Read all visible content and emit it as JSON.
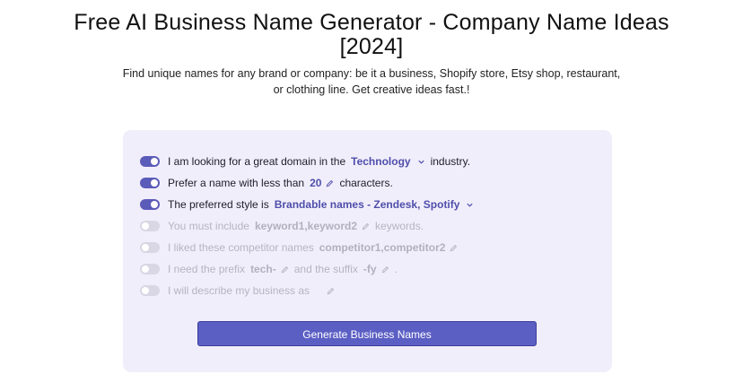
{
  "page": {
    "title_line1": "Free AI Business Name Generator - Company Name Ideas",
    "title_line2": "[2024]",
    "subtitle": "Find unique names for any brand or company: be it a business, Shopify store, Etsy shop, restaurant, or clothing line. Get creative ideas fast.!"
  },
  "form": {
    "rows": [
      {
        "enabled": true,
        "before": "I am looking for a great domain in the",
        "value": "Technology",
        "after": "industry."
      },
      {
        "enabled": true,
        "before": "Prefer a name with less than",
        "value": "20",
        "after": "characters."
      },
      {
        "enabled": true,
        "before": "The preferred style is",
        "value": "Brandable names - Zendesk, Spotify",
        "after": ""
      },
      {
        "enabled": false,
        "before": "You must include",
        "value": "keyword1,keyword2",
        "after": "keywords."
      },
      {
        "enabled": false,
        "before": "I liked these competitor names",
        "value": "competitor1,competitor2",
        "after": ""
      },
      {
        "enabled": false,
        "before": "I need the prefix",
        "value": "tech-",
        "middle": "and the suffix",
        "value2": "-fy",
        "after": "."
      },
      {
        "enabled": false,
        "before": "I will describe my business as",
        "value": "",
        "after": ""
      }
    ],
    "generate_label": "Generate Business Names"
  },
  "icons": {
    "dropdown": "chevron-down-icon",
    "edit": "pencil-icon"
  },
  "colors": {
    "accent": "#5b5fc4",
    "panel_bg": "#f1eefb",
    "toggle_off": "#d9d7e4"
  }
}
